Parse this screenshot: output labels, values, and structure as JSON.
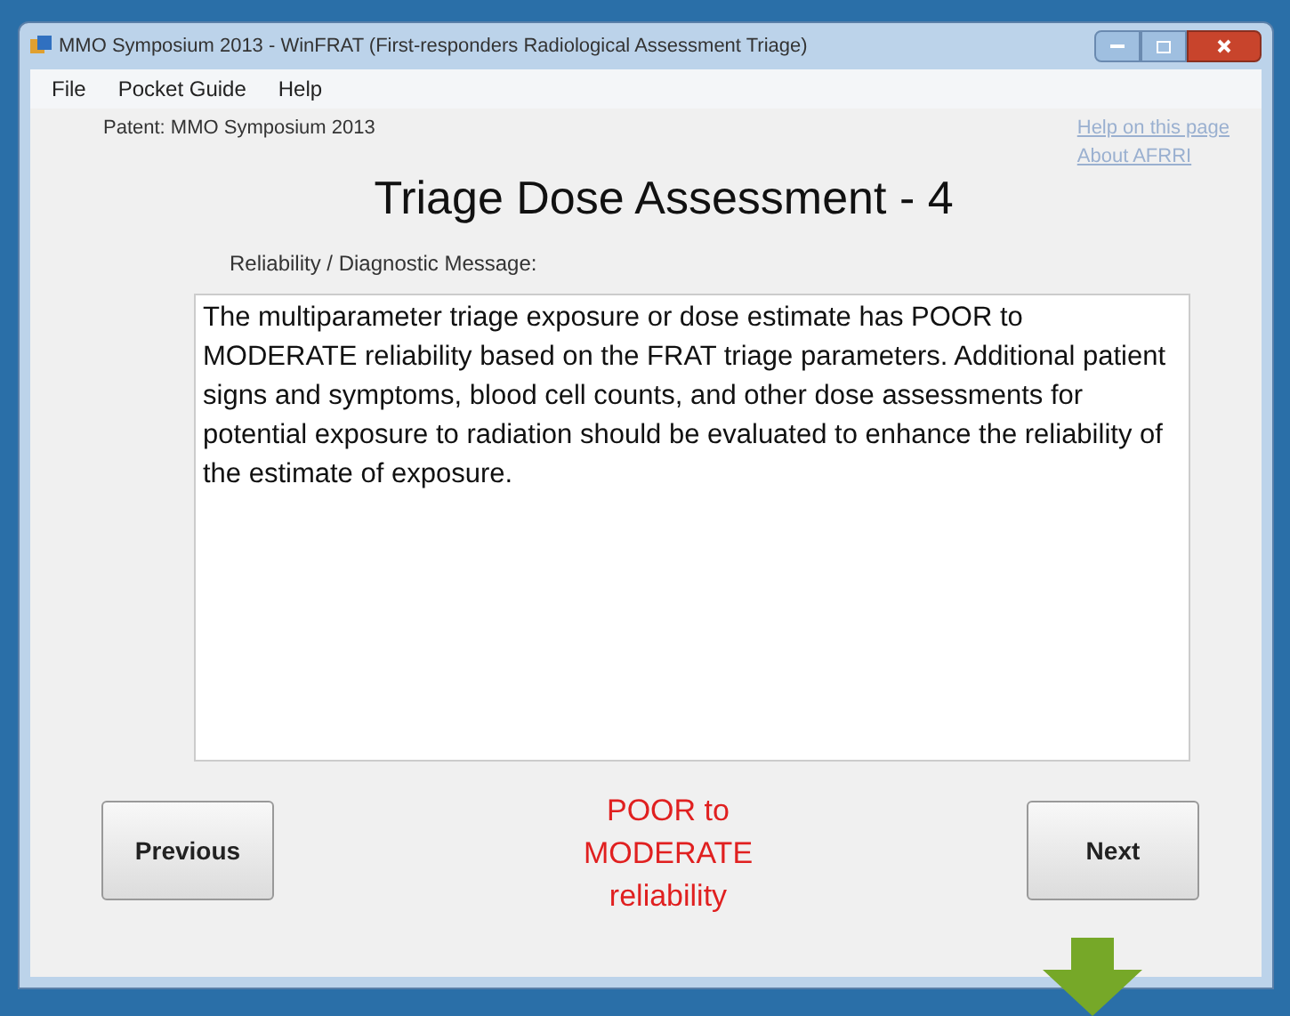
{
  "window": {
    "title": "MMO Symposium 2013 - WinFRAT (First-responders Radiological Assessment Triage)"
  },
  "menu": [
    "File",
    "Pocket Guide",
    "Help"
  ],
  "patient_label": "Patent: MMO Symposium 2013",
  "links": [
    "Help on this page",
    "About AFRRI"
  ],
  "heading": "Triage Dose Assessment - 4",
  "message_label": "Reliability / Diagnostic Message:",
  "message": "The multiparameter triage exposure or dose estimate has POOR to MODERATE reliability based on the FRAT triage parameters. Additional patient signs and symptoms, blood cell counts, and other dose assessments for potential exposure to radiation should be evaluated to enhance the reliability of the estimate of exposure.",
  "buttons": [
    "Previous",
    "Next"
  ],
  "reliability": [
    "POOR to",
    "MODERATE",
    "reliability"
  ]
}
